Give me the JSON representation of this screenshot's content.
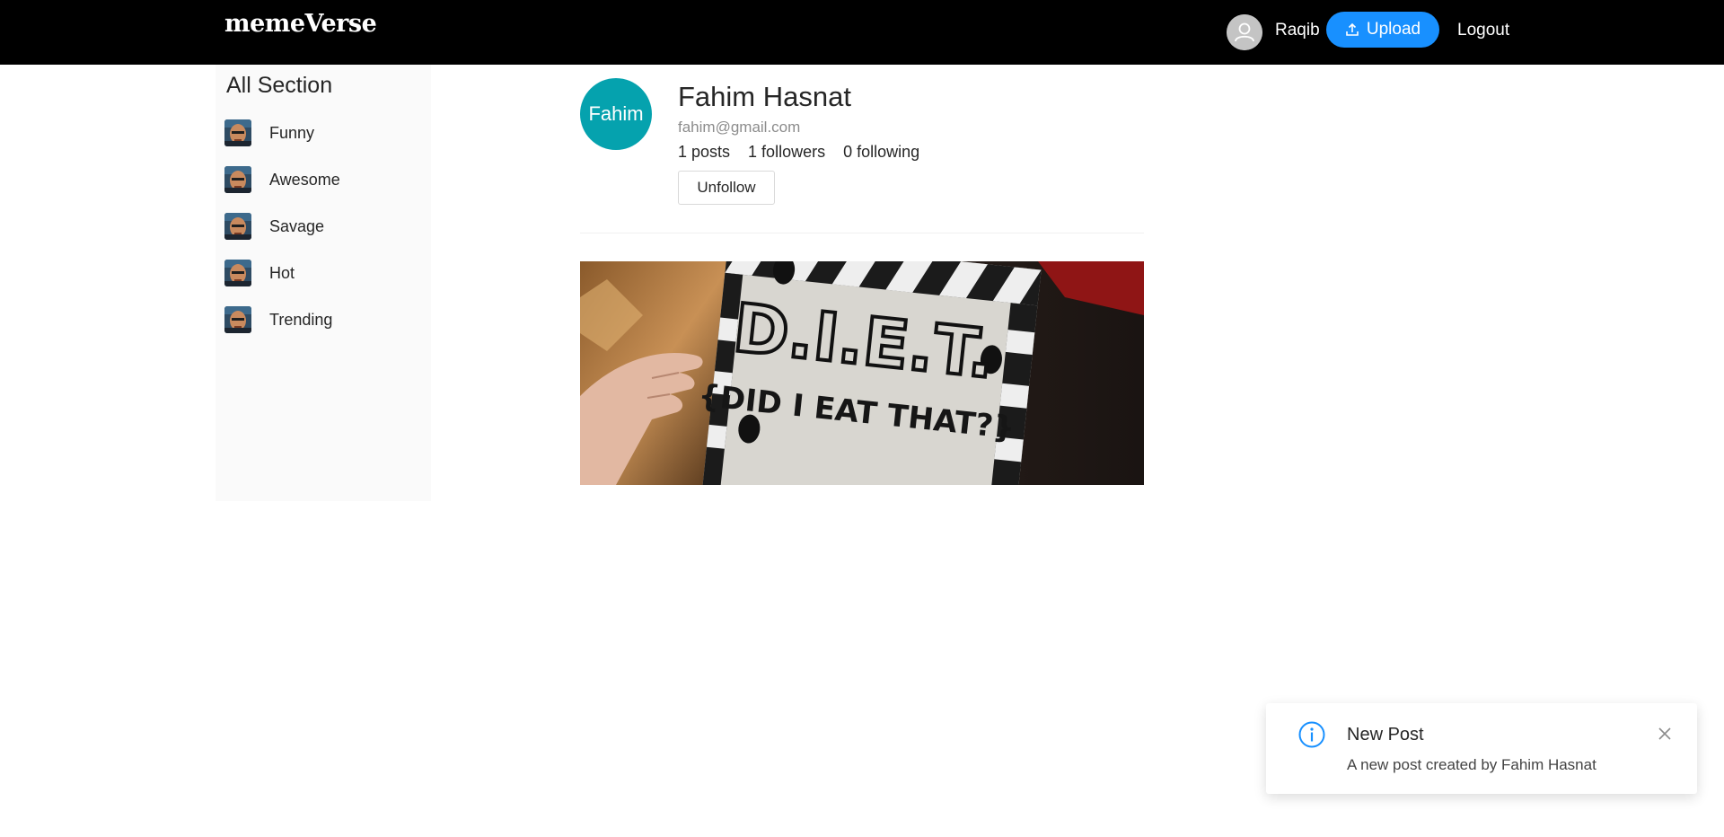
{
  "header": {
    "logo": "memeVerse",
    "user_name": "Raqib",
    "upload_label": "Upload",
    "logout_label": "Logout",
    "background": "#000000",
    "accent": "#1890ff"
  },
  "sidebar": {
    "title": "All Section",
    "items": [
      {
        "label": "Funny",
        "icon": "meme-thumbnail"
      },
      {
        "label": "Awesome",
        "icon": "meme-thumbnail"
      },
      {
        "label": "Savage",
        "icon": "meme-thumbnail"
      },
      {
        "label": "Hot",
        "icon": "meme-thumbnail"
      },
      {
        "label": "Trending",
        "icon": "meme-thumbnail"
      }
    ]
  },
  "profile": {
    "avatar_text": "Fahim",
    "avatar_color": "#05a2ae",
    "name": "Fahim Hasnat",
    "email": "fahim@gmail.com",
    "posts": "1 posts",
    "followers": "1 followers",
    "following": "0 following",
    "unfollow_label": "Unfollow"
  },
  "post": {
    "image_text_main": "D.I.E.T.",
    "image_text_sub": "{DID I EAT THAT?}"
  },
  "notification": {
    "icon": "info-icon",
    "title": "New Post",
    "message": "A new post created by Fahim Hasnat"
  }
}
